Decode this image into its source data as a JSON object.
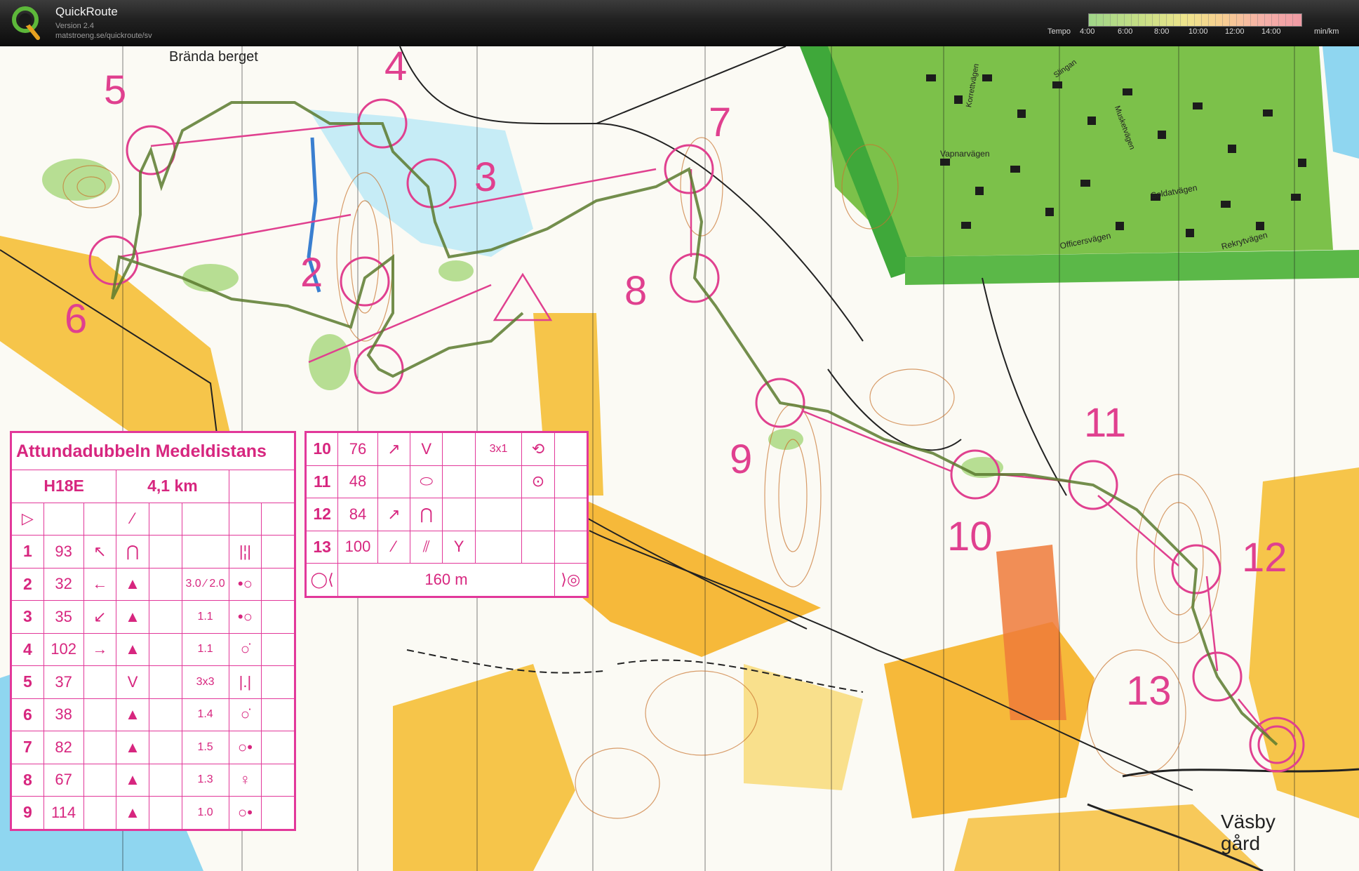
{
  "header": {
    "app_name": "QuickRoute",
    "version": "Version 2.4",
    "url": "matstroeng.se/quickroute/sv",
    "tempo_legend": {
      "label": "Tempo",
      "ticks": [
        "4:00",
        "6:00",
        "8:00",
        "10:00",
        "12:00",
        "14:00"
      ],
      "unit": "min/km"
    }
  },
  "map": {
    "place_names": [
      "Brända berget",
      "Väsby gård",
      "Vapnarvägen",
      "Soldatvägen",
      "Officersvägen",
      "Rekrytvägen",
      "Korrettvägen",
      "Musketvägen",
      "Slingan"
    ],
    "control_numbers": [
      "2",
      "3",
      "4",
      "5",
      "6",
      "7",
      "8",
      "9",
      "10",
      "11",
      "12",
      "13"
    ],
    "colors": {
      "course": "#e0408f",
      "route": "#556b2f",
      "yellow": "#f6c54a",
      "green": "#9ccc5a",
      "blue": "#7fd0ee"
    }
  },
  "descriptions_left": {
    "title": "Attundadubbeln Medeldistans",
    "class": "H18E",
    "length": "4,1 km",
    "rows": [
      {
        "n": "1",
        "code": "93",
        "dir": "↖",
        "feat": "⋂",
        "dim": "",
        "loc": "|¦|"
      },
      {
        "n": "2",
        "code": "32",
        "dir": "←",
        "feat": "▲",
        "dim": "3.0 ⁄ 2.0",
        "loc": "•○"
      },
      {
        "n": "3",
        "code": "35",
        "dir": "↙",
        "feat": "▲",
        "dim": "1.1",
        "loc": "•○"
      },
      {
        "n": "4",
        "code": "102",
        "dir": "→",
        "feat": "▲",
        "dim": "1.1",
        "loc": "○̇"
      },
      {
        "n": "5",
        "code": "37",
        "dir": "",
        "feat": "V",
        "dim": "3x3",
        "loc": "|.|"
      },
      {
        "n": "6",
        "code": "38",
        "dir": "",
        "feat": "▲",
        "dim": "1.4",
        "loc": "○̇"
      },
      {
        "n": "7",
        "code": "82",
        "dir": "",
        "feat": "▲",
        "dim": "1.5",
        "loc": "○•"
      },
      {
        "n": "8",
        "code": "67",
        "dir": "",
        "feat": "▲",
        "dim": "1.3",
        "loc": "♀"
      },
      {
        "n": "9",
        "code": "114",
        "dir": "",
        "feat": "▲",
        "dim": "1.0",
        "loc": "○•"
      }
    ]
  },
  "descriptions_right": {
    "rows": [
      {
        "n": "10",
        "code": "76",
        "dir": "↗",
        "feat": "V",
        "dim": "3x1",
        "loc": "⟲"
      },
      {
        "n": "11",
        "code": "48",
        "dir": "",
        "feat": "⬭",
        "dim": "",
        "loc": "⊙"
      },
      {
        "n": "12",
        "code": "84",
        "dir": "↗",
        "feat": "⋂",
        "dim": "",
        "loc": ""
      },
      {
        "n": "13",
        "code": "100",
        "dir": "⁄",
        "feat": "⫽",
        "dim": "Y",
        "loc": ""
      }
    ],
    "finish_distance": "160 m"
  }
}
